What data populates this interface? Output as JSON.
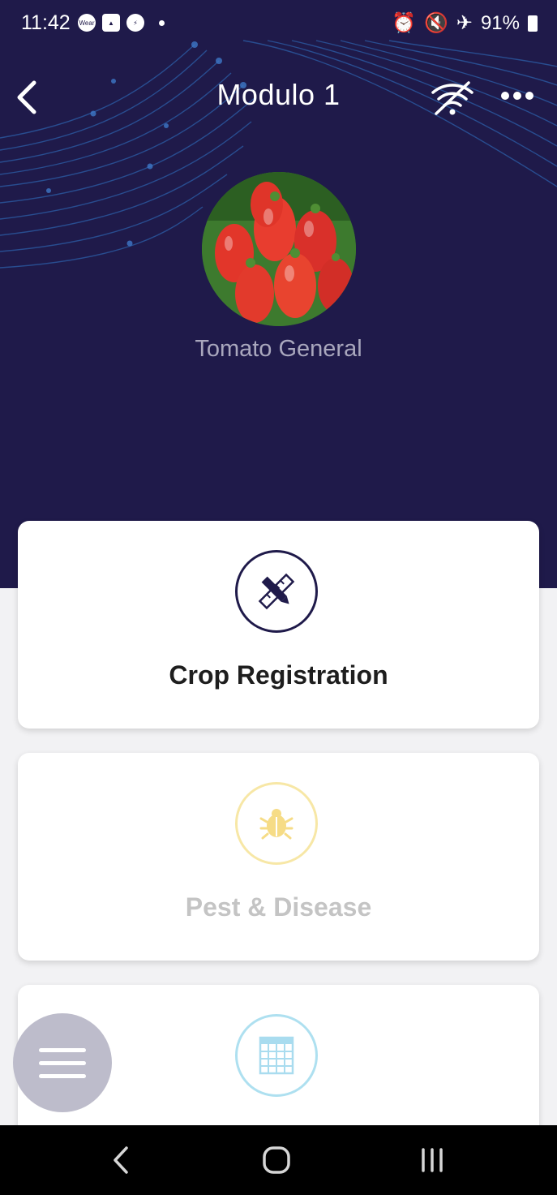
{
  "status_bar": {
    "time": "11:42",
    "left_icons": [
      "wear-icon",
      "gallery-icon",
      "messenger-icon",
      "notification-dot"
    ],
    "wear_label": "Wear",
    "right_icons": [
      "alarm-icon",
      "mute-icon",
      "airplane-icon"
    ],
    "battery": "91%"
  },
  "header": {
    "title": "Modulo 1",
    "back_icon": "chevron-left-icon",
    "wifi_icon": "wifi-off-icon",
    "more_icon": "more-horizontal-icon"
  },
  "crop": {
    "name": "Tomato General",
    "image": "tomato-photo"
  },
  "cards": [
    {
      "label": "Crop Registration",
      "icon": "pencil-ruler-icon",
      "enabled": true,
      "accent": "#1f1a4a"
    },
    {
      "label": "Pest & Disease",
      "icon": "bug-icon",
      "enabled": false,
      "accent": "#f7e7a6"
    },
    {
      "label": "",
      "icon": "calendar-grid-icon",
      "enabled": false,
      "accent": "#aee0f0"
    }
  ],
  "fab": {
    "icon": "menu-icon"
  },
  "colors": {
    "header_bg": "#1f1a4a",
    "page_bg": "#f2f2f4",
    "crop_name": "#a9a7bd",
    "fab_bg": "#bdbccb"
  },
  "system_nav": [
    "back-nav-icon",
    "home-nav-icon",
    "recents-nav-icon"
  ]
}
